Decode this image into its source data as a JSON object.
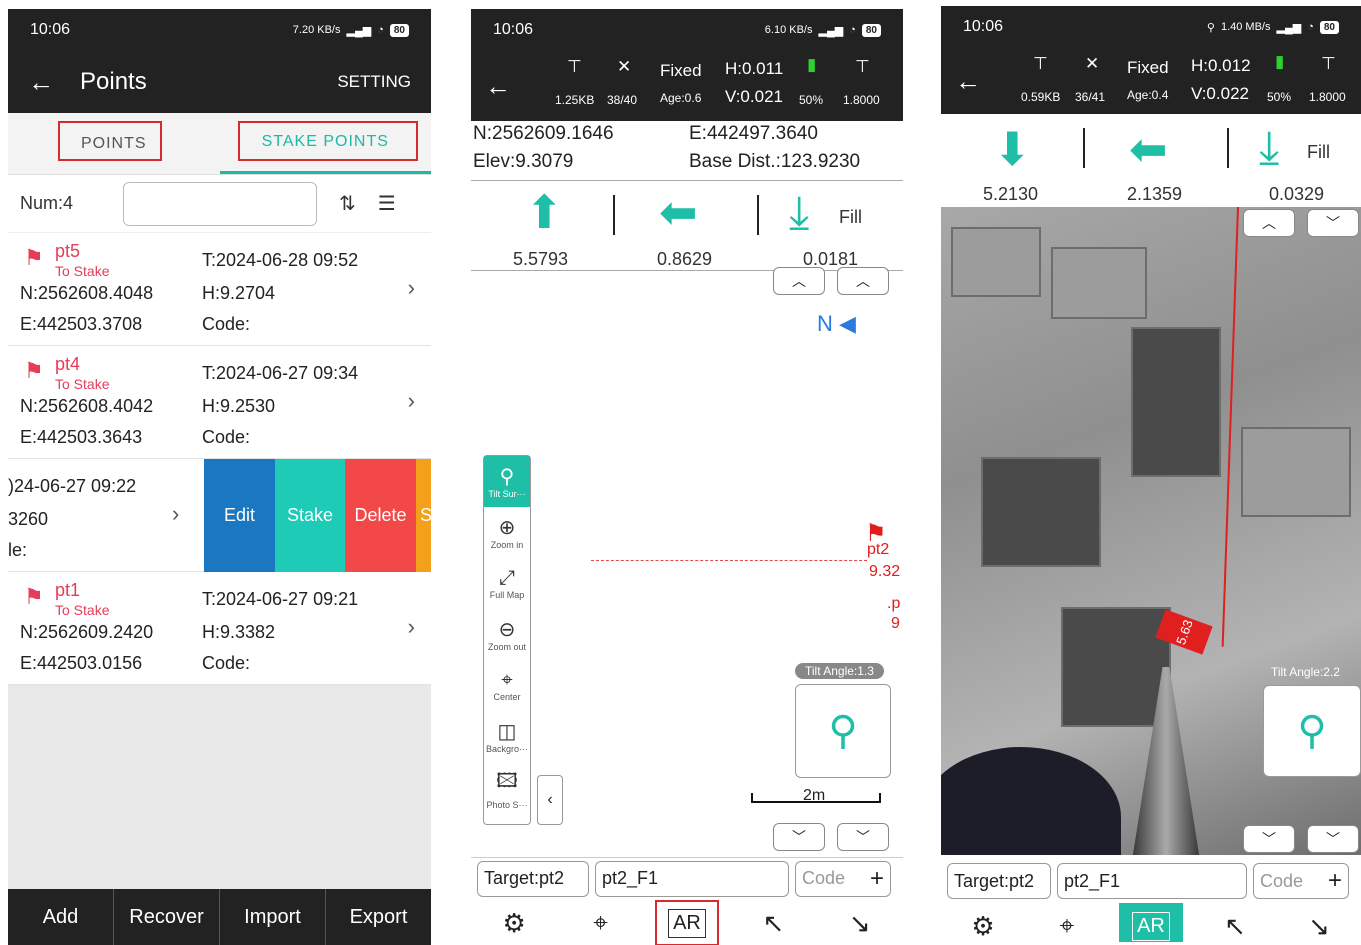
{
  "screen1": {
    "status": {
      "time": "10:06",
      "net": "7.20 KB/s",
      "battery": "80"
    },
    "appbar": {
      "back": "←",
      "title": "Points",
      "setting": "SETTING"
    },
    "tabs": [
      {
        "label": "POINTS"
      },
      {
        "label": "STAKE POINTS"
      }
    ],
    "filter": {
      "num": "Num:4",
      "value": ""
    },
    "rows": [
      {
        "name": "pt5",
        "status": "To Stake",
        "t": "T:2024-06-28 09:52",
        "n": "N:2562608.4048",
        "h": "H:9.2704",
        "e": "E:442503.3708",
        "code": "Code:"
      },
      {
        "name": "pt4",
        "status": "To Stake",
        "t": "T:2024-06-27 09:34",
        "n": "N:2562608.4042",
        "h": "H:9.2530",
        "e": "E:442503.3643",
        "code": "Code:"
      },
      {
        "t": ")24-06-27 09:22",
        "h": "3260",
        "code": "le:"
      },
      {
        "name": "pt1",
        "status": "To Stake",
        "t": "T:2024-06-27 09:21",
        "n": "N:2562609.2420",
        "h": "H:9.3382",
        "e": "E:442503.0156",
        "code": "Code:"
      }
    ],
    "swipe_actions": {
      "edit": "Edit",
      "stake": "Stake",
      "delete": "Delete",
      "more": "S"
    },
    "bottom": [
      "Add",
      "Recover",
      "Import",
      "Export"
    ]
  },
  "screen2": {
    "status": {
      "time": "10:06",
      "net": "6.10 KB/s",
      "battery": "80"
    },
    "gnss": {
      "datalink": "1.25KB",
      "sats": "38/40",
      "fix": "Fixed",
      "age": "Age:0.6",
      "h": "H:0.011",
      "v": "V:0.021",
      "battery": "50%",
      "height": "1.8000"
    },
    "coords": {
      "n": "N:2562609.1646",
      "e": "E:442497.3640",
      "elev": "Elev:9.3079",
      "base": "Base Dist.:123.9230"
    },
    "dirs": {
      "forward": "5.5793",
      "left": "0.8629",
      "fill": "0.0181",
      "fill_label": "Fill"
    },
    "north": "N",
    "map": {
      "pt_label": "pt2",
      "pt_elev": "9.32",
      "pt2_label": ".p",
      "pt2_elev": "9",
      "scale": "2m"
    },
    "tools": [
      {
        "label": "Tilt Sur···"
      },
      {
        "label": "Zoom in"
      },
      {
        "label": "Full Map"
      },
      {
        "label": "Zoom out"
      },
      {
        "label": "Center"
      },
      {
        "label": "Backgro···"
      },
      {
        "label": "Photo S···"
      }
    ],
    "tilt_angle": "Tilt Angle:1.3",
    "target": {
      "label": "Target:pt2",
      "name": "pt2_F1",
      "code_placeholder": "Code"
    },
    "nav": {
      "ar": "AR"
    }
  },
  "screen3": {
    "status": {
      "time": "10:06",
      "net": "1.40 MB/s",
      "battery": "80"
    },
    "gnss": {
      "datalink": "0.59KB",
      "sats": "36/41",
      "fix": "Fixed",
      "age": "Age:0.4",
      "h": "H:0.012",
      "v": "V:0.022",
      "battery": "50%",
      "height": "1.8000"
    },
    "dirs": {
      "back": "5.2130",
      "left": "2.1359",
      "fill": "0.0329",
      "fill_label": "Fill"
    },
    "ar_distance": "5.63",
    "tilt_angle": "Tilt Angle:2.2",
    "target": {
      "label": "Target:pt2",
      "name": "pt2_F1",
      "code_placeholder": "Code"
    },
    "nav": {
      "ar": "AR"
    }
  }
}
